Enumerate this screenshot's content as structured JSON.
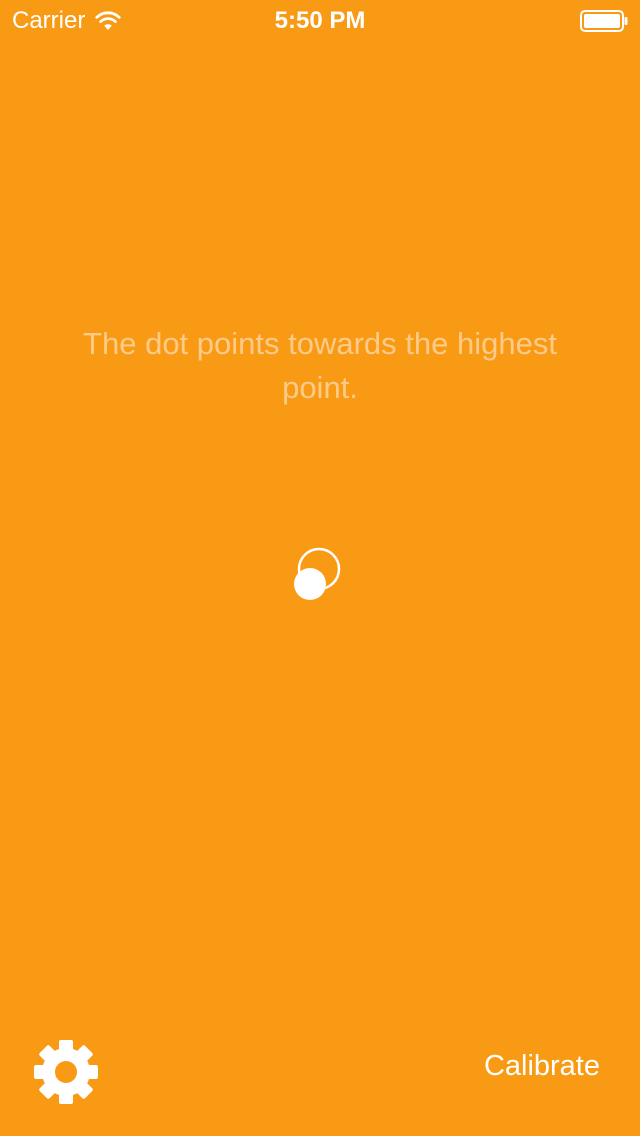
{
  "status_bar": {
    "carrier": "Carrier",
    "time": "5:50 PM",
    "wifi_icon": "wifi-icon",
    "battery_icon": "battery-icon"
  },
  "main": {
    "hint": "The dot points towards the highest point.",
    "level_indicator": "level-dot-icon"
  },
  "toolbar": {
    "settings_icon": "gear-icon",
    "calibrate_label": "Calibrate"
  },
  "colors": {
    "background": "#F99A15",
    "foreground": "#FFFFFF",
    "hint_text": "#FCCB89"
  }
}
